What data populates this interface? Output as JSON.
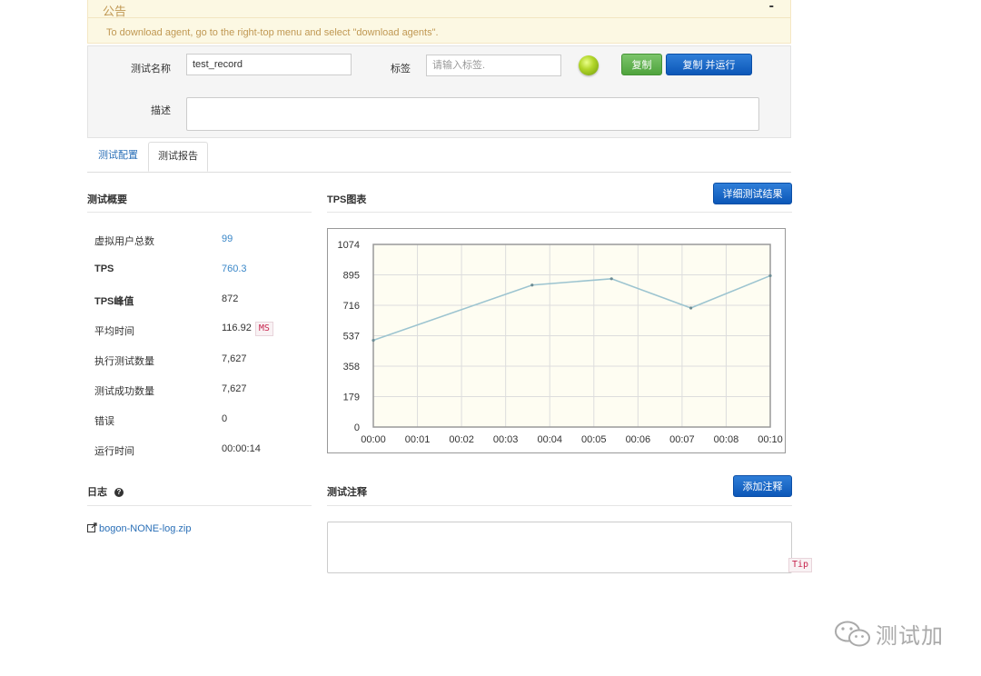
{
  "notice": {
    "title": "公告",
    "collapse_symbol": "-",
    "text": "To download agent, go to the right-top menu and select \"download agents\"."
  },
  "form": {
    "test_name_label": "测试名称",
    "test_name_value": "test_record",
    "tag_label": "标签",
    "tag_placeholder": "请输入标签.",
    "copy_button": "复制",
    "copy_run_button": "复制 并运行",
    "description_label": "描述",
    "description_value": "",
    "status_indicator": "green-ball-icon"
  },
  "tabs": [
    {
      "label": "测试配置",
      "active": false
    },
    {
      "label": "测试报告",
      "active": true
    }
  ],
  "summary": {
    "title": "测试概要",
    "rows": [
      {
        "label": "虚拟用户总数",
        "value": "99"
      },
      {
        "label": "TPS",
        "value": "760.3"
      },
      {
        "label": "TPS峰值",
        "value": "872"
      },
      {
        "label": "平均时间",
        "value": "116.92",
        "unit": "MS"
      },
      {
        "label": "执行测试数量",
        "value": "7,627"
      },
      {
        "label": "测试成功数量",
        "value": "7,627"
      },
      {
        "label": "错误",
        "value": "0"
      },
      {
        "label": "运行时间",
        "value": "00:00:14"
      }
    ]
  },
  "tps": {
    "title": "TPS图表",
    "detail_button": "详细测试结果"
  },
  "chart_data": {
    "type": "line",
    "x": [
      "00:00",
      "00:01",
      "00:02",
      "00:03",
      "00:04",
      "00:05",
      "00:06",
      "00:07",
      "00:08",
      "00:10"
    ],
    "y_ticks": [
      0,
      179,
      358,
      537,
      716,
      895,
      1074
    ],
    "ylim": [
      0,
      1074
    ],
    "grid": true,
    "series": [
      {
        "color": "#9cc4d0",
        "points": [
          {
            "x": 0.0,
            "y": 510
          },
          {
            "x": 3.6,
            "y": 835
          },
          {
            "x": 5.4,
            "y": 872
          },
          {
            "x": 7.2,
            "y": 700
          },
          {
            "x": 9.0,
            "y": 890
          }
        ]
      }
    ]
  },
  "log": {
    "title": "日志",
    "help_symbol": "?",
    "file_link": "bogon-NONE-log.zip"
  },
  "notes": {
    "title": "测试注释",
    "add_button": "添加注释",
    "tip": "Tip"
  },
  "watermark": {
    "text": "测试加"
  },
  "colors": {
    "notice_bg": "#fcf8e3",
    "link": "#2a6fb7",
    "btn_blue": "#1a6ac8",
    "btn_green": "#5cb85c",
    "badge_red": "#c7254e"
  }
}
